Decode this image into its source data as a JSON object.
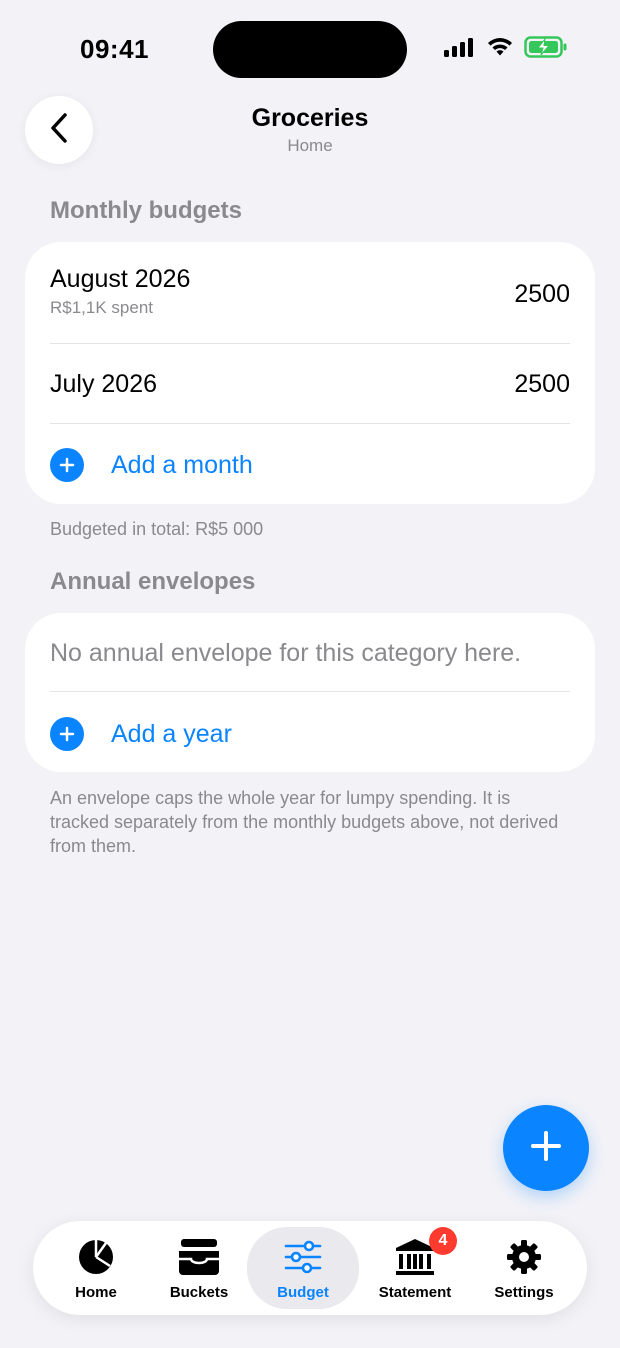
{
  "status_bar": {
    "time": "09:41"
  },
  "nav": {
    "title": "Groceries",
    "subtitle": "Home"
  },
  "monthly": {
    "header": "Monthly budgets",
    "rows": [
      {
        "title": "August 2026",
        "subtitle": "R$1,1K spent",
        "value": "2500"
      },
      {
        "title": "July 2026",
        "value": "2500"
      }
    ],
    "add_label": "Add a month",
    "footnote": "Budgeted in total: R$5 000"
  },
  "annual": {
    "header": "Annual envelopes",
    "empty_text": "No annual envelope for this category here.",
    "add_label": "Add a year",
    "footnote": "An envelope caps the whole year for lumpy spending. It is tracked separately from the monthly budgets above, not derived from them."
  },
  "tab_bar": {
    "tabs": [
      {
        "label": "Home",
        "icon": "pie-chart-icon"
      },
      {
        "label": "Buckets",
        "icon": "tray-icon"
      },
      {
        "label": "Budget",
        "icon": "sliders-icon",
        "active": true
      },
      {
        "label": "Statement",
        "icon": "bank-icon",
        "badge": "4"
      },
      {
        "label": "Settings",
        "icon": "gear-icon"
      }
    ]
  },
  "colors": {
    "accent": "#0a84ff",
    "background": "#f2f2f7",
    "badge": "#ff3b30",
    "secondary_text": "#8a8a8e"
  }
}
